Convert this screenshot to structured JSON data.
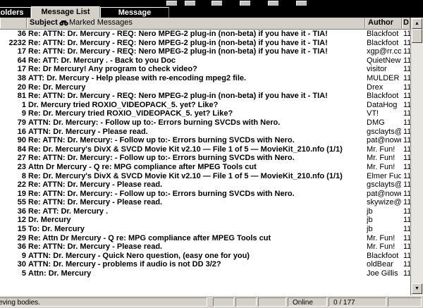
{
  "tabs": {
    "folders": "olders",
    "message_list": "Message List",
    "message": "Message"
  },
  "columns": {
    "subject": "Subject",
    "marked": "Marked Messages",
    "author": "Author",
    "date": "D"
  },
  "messages": [
    {
      "num": "36",
      "subject": "Re: ATTN: Dr. Mercury - REQ: Nero MPEG-2 plug-in (non-beta) if you have it - TIA!",
      "author": "Blackfoot",
      "date": "11"
    },
    {
      "num": "2232",
      "subject": "Re: ATTN: Dr. Mercury - REQ: Nero MPEG-2 plug-in (non-beta) if you have it - TIA!",
      "author": "Blackfoot",
      "date": "11"
    },
    {
      "num": "17",
      "subject": "Re: ATTN: Dr. Mercury - REQ: Nero MPEG-2 plug-in (non-beta) if you have it - TIA!",
      "author": "xgp@rr.co",
      "date": "11"
    },
    {
      "num": "64",
      "subject": "Re: ATT: Dr. Mercury . - Back to you Doc",
      "author": "QuietNewb",
      "date": "11"
    },
    {
      "num": "17",
      "subject": "Re: Dr Mercury! Any program to check video?",
      "author": "visitor",
      "date": "11"
    },
    {
      "num": "38",
      "subject": "ATT: Dr. Mercury - Help please with re-encoding mpeg2 file.",
      "author": "MULDER",
      "date": "11"
    },
    {
      "num": "20",
      "subject": "Re: Dr. Mercury",
      "author": "Drex",
      "date": "11"
    },
    {
      "num": "81",
      "subject": "Re: ATTN: Dr. Mercury - REQ: Nero MPEG-2 plug-in (non-beta) if you have it - TIA!",
      "author": "Blackfoot",
      "date": "11"
    },
    {
      "num": "1",
      "subject": "Dr. Mercury tried ROXIO_VIDEOPACK_5. yet? Like?",
      "author": "DataHog",
      "date": "11"
    },
    {
      "num": "9",
      "subject": "Re: Dr. Mercury tried ROXIO_VIDEOPACK_5. yet? Like?",
      "author": "VT!",
      "date": "11"
    },
    {
      "num": "79",
      "subject": "ATTN: Dr. Mercury:  - Follow up to:-   Errors burning SVCDs with Nero.",
      "author": "DMG",
      "date": "11"
    },
    {
      "num": "16",
      "subject": "ATTN: Dr. Mercury - Please read.",
      "author": "gsclayts@",
      "date": "11"
    },
    {
      "num": "90",
      "subject": "Re: ATTN: Dr. Mercury:  - Follow up to:-   Errors burning SVCDs with Nero.",
      "author": "pat@nowe",
      "date": "11"
    },
    {
      "num": "84",
      "subject": "Re: Dr. Mercury's DivX & SVCD Movie Kit v2.10 — File 1 of 5 — MovieKit_210.nfo (1/1)",
      "author": "Mr. Fun!",
      "date": "11"
    },
    {
      "num": "27",
      "subject": "Re: ATTN: Dr. Mercury:  - Follow up to:-   Errors burning SVCDs with Nero.",
      "author": "Mr. Fun!",
      "date": "11"
    },
    {
      "num": "23",
      "subject": "Attn Dr Mercury - Q re: MPG compliance after MPEG Tools cut",
      "author": "Mr. Fun!",
      "date": "11"
    },
    {
      "num": "8",
      "subject": "Re: Dr. Mercury's DivX & SVCD Movie Kit v2.10 — File 1 of 5 — MovieKit_210.nfo (1/1)",
      "author": "Elmer Fud",
      "date": "11"
    },
    {
      "num": "22",
      "subject": "Re: ATTN: Dr. Mercury - Please read.",
      "author": "gsclayts@",
      "date": "11"
    },
    {
      "num": "19",
      "subject": "Re: ATTN: Dr. Mercury:  - Follow up to:-   Errors burning SVCDs with Nero.",
      "author": "pat@nowe",
      "date": "11"
    },
    {
      "num": "55",
      "subject": "Re: ATTN: Dr. Mercury - Please read.",
      "author": "skywize@",
      "date": "11"
    },
    {
      "num": "36",
      "subject": "Re: ATT: Dr. Mercury .",
      "author": "jb",
      "date": "11"
    },
    {
      "num": "12",
      "subject": "Dr. Mercury",
      "author": "jb",
      "date": "11"
    },
    {
      "num": "15",
      "subject": "To: Dr. Mercury",
      "author": "jb",
      "date": "11"
    },
    {
      "num": "29",
      "subject": "Re: Attn Dr Mercury - Q re: MPG compliance after MPEG Tools cut",
      "author": "Mr. Fun!",
      "date": "11"
    },
    {
      "num": "36",
      "subject": "Re: ATTN: Dr. Mercury - Please read.",
      "author": "Mr. Fun!",
      "date": "11"
    },
    {
      "num": "9",
      "subject": "ATTN: Dr. Mercury - Quick Nero question, (easy one for you)",
      "author": "Blackfoot",
      "date": "11"
    },
    {
      "num": "30",
      "subject": "ATTN: Dr. Mercury - problems if audio is not DD 3/2?",
      "author": "oldBear",
      "date": "11"
    },
    {
      "num": "5",
      "subject": "Attn: Dr. Mercury",
      "author": "Joe Gillis",
      "date": "11"
    }
  ],
  "status": {
    "text": "eving bodies.",
    "online": "Online",
    "count": "0 / 177"
  }
}
